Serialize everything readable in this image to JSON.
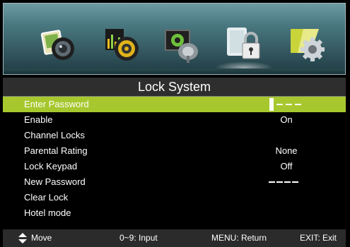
{
  "icons": [
    {
      "name": "picture-icon"
    },
    {
      "name": "sound-icon"
    },
    {
      "name": "channel-icon"
    },
    {
      "name": "lock-icon",
      "selected": true
    },
    {
      "name": "setup-icon"
    }
  ],
  "title": "Lock System",
  "rows": [
    {
      "label": "Enter Password",
      "value": ""
    },
    {
      "label": "Enable",
      "value": "On"
    },
    {
      "label": "Channel Locks",
      "value": ""
    },
    {
      "label": "Parental Rating",
      "value": "None"
    },
    {
      "label": "Lock Keypad",
      "value": "Off"
    },
    {
      "label": "New Password",
      "value": ""
    },
    {
      "label": "Clear Lock",
      "value": ""
    },
    {
      "label": "Hotel mode",
      "value": ""
    }
  ],
  "help": {
    "move": "Move",
    "input": "0~9: Input",
    "return": "MENU: Return",
    "exit": "EXIT: Exit"
  },
  "colors": {
    "highlight": "#a6c82e",
    "icon_bar": "#4a7880",
    "help_bar": "#2b2b2b"
  }
}
